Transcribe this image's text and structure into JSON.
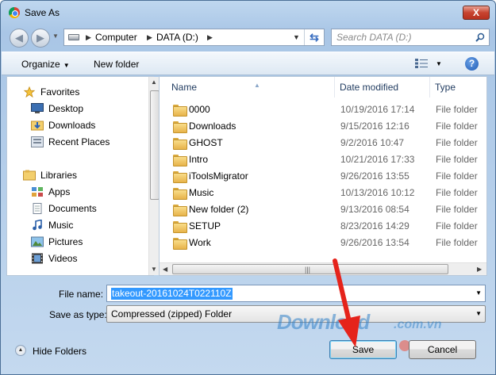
{
  "window": {
    "title": "Save As",
    "close_label": "X"
  },
  "address": {
    "crumbs": [
      "Computer",
      "DATA (D:)"
    ],
    "search_placeholder": "Search DATA (D:)"
  },
  "toolbar": {
    "organize": "Organize",
    "new_folder": "New folder",
    "help": "?"
  },
  "sidebar": {
    "favorites_header": "Favorites",
    "favorites": [
      {
        "label": "Desktop",
        "icon": "desktop-icon"
      },
      {
        "label": "Downloads",
        "icon": "downloads-folder-icon"
      },
      {
        "label": "Recent Places",
        "icon": "recent-places-icon"
      }
    ],
    "libraries_header": "Libraries",
    "libraries": [
      {
        "label": "Apps",
        "icon": "apps-icon"
      },
      {
        "label": "Documents",
        "icon": "documents-icon"
      },
      {
        "label": "Music",
        "icon": "music-icon"
      },
      {
        "label": "Pictures",
        "icon": "pictures-icon"
      },
      {
        "label": "Videos",
        "icon": "videos-icon"
      }
    ]
  },
  "file_list": {
    "columns": [
      "Name",
      "Date modified",
      "Type"
    ],
    "rows": [
      {
        "name": "0000",
        "date": "10/19/2016 17:14",
        "type": "File folder"
      },
      {
        "name": "Downloads",
        "date": "9/15/2016 12:16",
        "type": "File folder"
      },
      {
        "name": "GHOST",
        "date": "9/2/2016 10:47",
        "type": "File folder"
      },
      {
        "name": "Intro",
        "date": "10/21/2016 17:33",
        "type": "File folder"
      },
      {
        "name": "iToolsMigrator",
        "date": "9/26/2016 13:55",
        "type": "File folder"
      },
      {
        "name": "Music",
        "date": "10/13/2016 10:12",
        "type": "File folder"
      },
      {
        "name": "New folder (2)",
        "date": "9/13/2016 08:54",
        "type": "File folder"
      },
      {
        "name": "SETUP",
        "date": "8/23/2016 14:29",
        "type": "File folder"
      },
      {
        "name": "Work",
        "date": "9/26/2016 13:54",
        "type": "File folder"
      }
    ]
  },
  "save_form": {
    "file_name_label": "File name:",
    "file_name_value": "takeout-20161024T022110Z",
    "save_type_label": "Save as type:",
    "save_type_value": "Compressed (zipped) Folder"
  },
  "footer": {
    "hide_folders": "Hide Folders",
    "save": "Save",
    "cancel": "Cancel"
  },
  "watermark": {
    "text": "Download",
    "suffix": ".com.vn"
  },
  "colors": {
    "accent": "#3399ff",
    "arrow": "#e5231b"
  }
}
